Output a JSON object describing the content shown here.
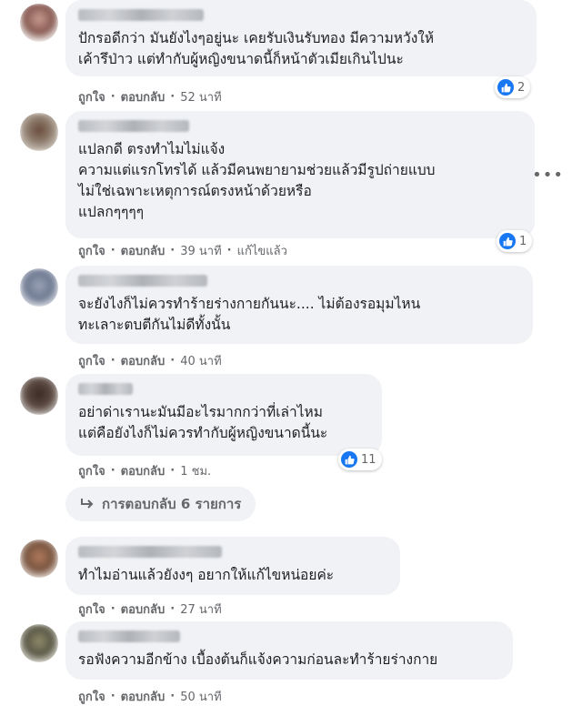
{
  "actions": {
    "like": "ถูกใจ",
    "reply": "ตอบกลับ",
    "edited": "แก้ไขแล้ว"
  },
  "comments": [
    {
      "text": "ปักรอดีกว่า มันยังไงๆอยู่นะ เคยรับเงินรับทอง มีความหวังให้\nเค้ารึป่าว แต่ทำกับผู้หญิงขนาดนี้ก็หน้าตัวเมียเกินไปนะ",
      "time": "52 นาที",
      "reactions": "2"
    },
    {
      "text": "แปลกดี ตรงทำไมไม่แจ้ง\nความแต่แรกโทรได้ แล้วมีคนพยายามช่วยแล้วมีรูปถ่ายแบบ\nไม่ใช่เฉพาะเหตุการณ์ตรงหน้าด้วยหรือ\nแปลกๆๆๆๆ",
      "time": "39 นาที",
      "reactions": "1"
    },
    {
      "text": "จะยังไงก็ไม่ควรทำร้ายร่างกายกันนะ.... ไม่ต้องรอมุมไหน\nทะเลาะตบตีกันไม่ดีทั้งนั้น",
      "time": "40 นาที"
    },
    {
      "text": "อย่าด่าเรานะมันมีอะไรมากกว่าที่เล่าไหม\nแต่คือยังไงก็ไม่ควรทำกับผู้หญิงขนาดนี้นะ",
      "time": "1 ชม.",
      "reactions": "11"
    },
    {
      "text": "ทำไมอ่านแล้วยังงๆ อยากให้แก้ไขหน่อยค่ะ",
      "time": "27 นาที"
    },
    {
      "text": "รอฟังความอีกข้าง เบื้องต้นก็แจ้งความก่อนละทำร้ายร่างกาย",
      "time": "50 นาที"
    }
  ],
  "replies_link": "การตอบกลับ 6 รายการ",
  "icons": {
    "like": "like-icon",
    "reply_arrow": "reply-arrow-icon",
    "more": "more-options-icon"
  },
  "colors": {
    "like_blue": "#1877f2",
    "bubble": "#f0f2f5",
    "meta": "#65676b"
  }
}
